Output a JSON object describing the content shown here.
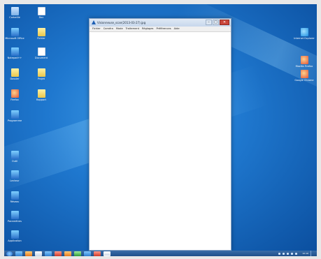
{
  "desktop": {
    "icons_left": [
      {
        "label": "Corbeille",
        "icon": "recycle-bin-icon"
      },
      {
        "label": "Microsoft Office",
        "icon": "app-icon"
      },
      {
        "label": "Notepad++",
        "icon": "app-icon"
      },
      {
        "label": "Dossier",
        "icon": "folder-icon"
      },
      {
        "label": "Firefox",
        "icon": "red-icon"
      },
      {
        "label": "Programme",
        "icon": "app-icon"
      }
    ],
    "icons_col2": [
      {
        "label": "Doc",
        "icon": "document-icon"
      },
      {
        "label": "Fichier",
        "icon": "folder-icon"
      },
      {
        "label": "Document",
        "icon": "document-icon"
      },
      {
        "label": "Projet",
        "icon": "folder-icon"
      },
      {
        "label": "Rapport",
        "icon": "folder-icon"
      }
    ],
    "icons_left_low": [
      {
        "label": "Outil",
        "icon": "app-icon"
      },
      {
        "label": "Lecteur",
        "icon": "app-icon"
      },
      {
        "label": "Réseau",
        "icon": "app-icon"
      },
      {
        "label": "Paramètres",
        "icon": "app-icon"
      },
      {
        "label": "Application",
        "icon": "app-icon"
      }
    ],
    "icons_right": [
      {
        "label": "Internet Explorer",
        "icon": "ie-icon"
      },
      {
        "label": "Mozilla Firefox",
        "icon": "red-icon"
      },
      {
        "label": "Google Chrome",
        "icon": "red-icon"
      }
    ]
  },
  "window": {
    "title": "Visionneuse_scan(2013-03-27).jpg",
    "menu": [
      "Fichier",
      "Caméra",
      "Mode",
      "Traitement",
      "Réglages",
      "Préférences",
      "Aide"
    ],
    "controls": {
      "minimize": "–",
      "maximize": "□",
      "close": "✕"
    }
  },
  "taskbar": {
    "clock": "10:16"
  }
}
